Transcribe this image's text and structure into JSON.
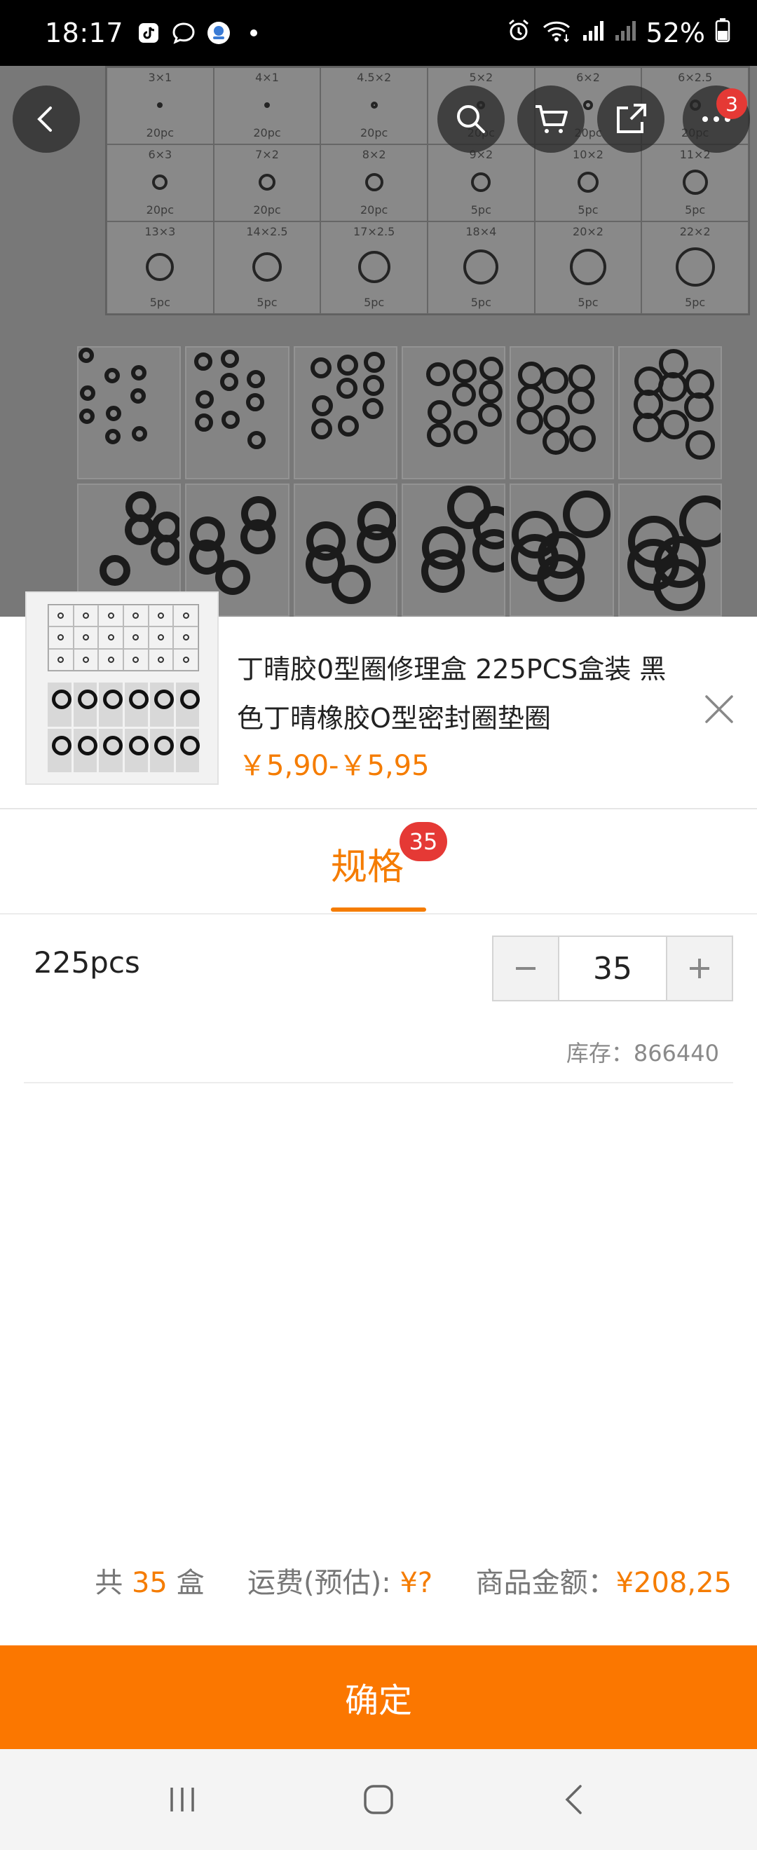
{
  "status_bar": {
    "time": "18:17",
    "battery": "52%",
    "left_icons": [
      "tiktok-icon",
      "chat-bubble-icon",
      "app-badge-icon",
      "dot-icon"
    ],
    "right_icons": [
      "alarm-icon",
      "wifi-icon",
      "signal-icon",
      "signal-icon-2",
      "battery-icon"
    ]
  },
  "hero": {
    "grid_labels": [
      {
        "size": "3×1",
        "qty": "20pc"
      },
      {
        "size": "4×1",
        "qty": "20pc"
      },
      {
        "size": "4.5×2",
        "qty": "20pc"
      },
      {
        "size": "5×2",
        "qty": "20pc"
      },
      {
        "size": "6×2",
        "qty": "20pc"
      },
      {
        "size": "6×2.5",
        "qty": "20pc"
      },
      {
        "size": "6×3",
        "qty": "20pc"
      },
      {
        "size": "7×2",
        "qty": "20pc"
      },
      {
        "size": "8×2",
        "qty": "20pc"
      },
      {
        "size": "9×2",
        "qty": "5pc"
      },
      {
        "size": "10×2",
        "qty": "5pc"
      },
      {
        "size": "11×2",
        "qty": "5pc"
      },
      {
        "size": "13×3",
        "qty": "5pc"
      },
      {
        "size": "14×2.5",
        "qty": "5pc"
      },
      {
        "size": "17×2.5",
        "qty": "5pc"
      },
      {
        "size": "18×4",
        "qty": "5pc"
      },
      {
        "size": "20×2",
        "qty": "5pc"
      },
      {
        "size": "22×2",
        "qty": "5pc"
      }
    ],
    "cart_count": "3"
  },
  "product": {
    "title": "丁晴胶0型圈修理盒 225PCS盒装 黑色丁晴橡胶O型密封圈垫圈",
    "price": "￥5,90-￥5,95"
  },
  "tabs": {
    "active_label": "规格",
    "badge": "35"
  },
  "spec": {
    "label": "225pcs",
    "quantity": "35",
    "stock": "库存：866440"
  },
  "summary": {
    "total_prefix": "共",
    "total_count": "35",
    "total_unit": "盒",
    "shipping_label": "运费(预估):",
    "shipping_value": "¥?",
    "amount_label": "商品金额：",
    "amount_value": "¥208,25"
  },
  "confirm_label": "确定",
  "colors": {
    "accent": "#f57c00",
    "button": "#fb7700",
    "badge": "#e53935"
  }
}
